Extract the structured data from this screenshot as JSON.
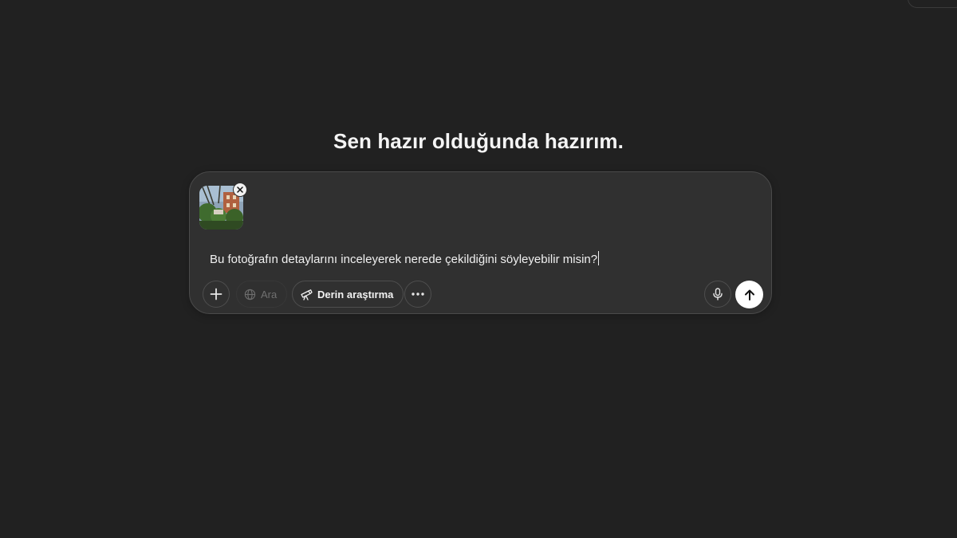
{
  "headline": "Sen hazır olduğunda hazırım.",
  "composer": {
    "attachment": {
      "type": "image",
      "icon": "photo-thumbnail",
      "remove_icon": "close-icon"
    },
    "prompt_text": "Bu fotoğrafın detaylarını inceleyerek nerede çekildiğini söyleyebilir misin?",
    "toolbar": {
      "add_icon": "plus-icon",
      "search": {
        "icon": "globe-icon",
        "label": "Ara",
        "enabled": false
      },
      "deep_research": {
        "icon": "telescope-icon",
        "label": "Derin araştırma"
      },
      "more_icon": "ellipsis-icon",
      "mic_icon": "microphone-icon",
      "send_icon": "arrow-up-icon"
    }
  },
  "colors": {
    "background": "#212121",
    "composer": "#303030",
    "border": "#4a4a4a",
    "text": "#ececec",
    "send_button": "#ffffff"
  }
}
